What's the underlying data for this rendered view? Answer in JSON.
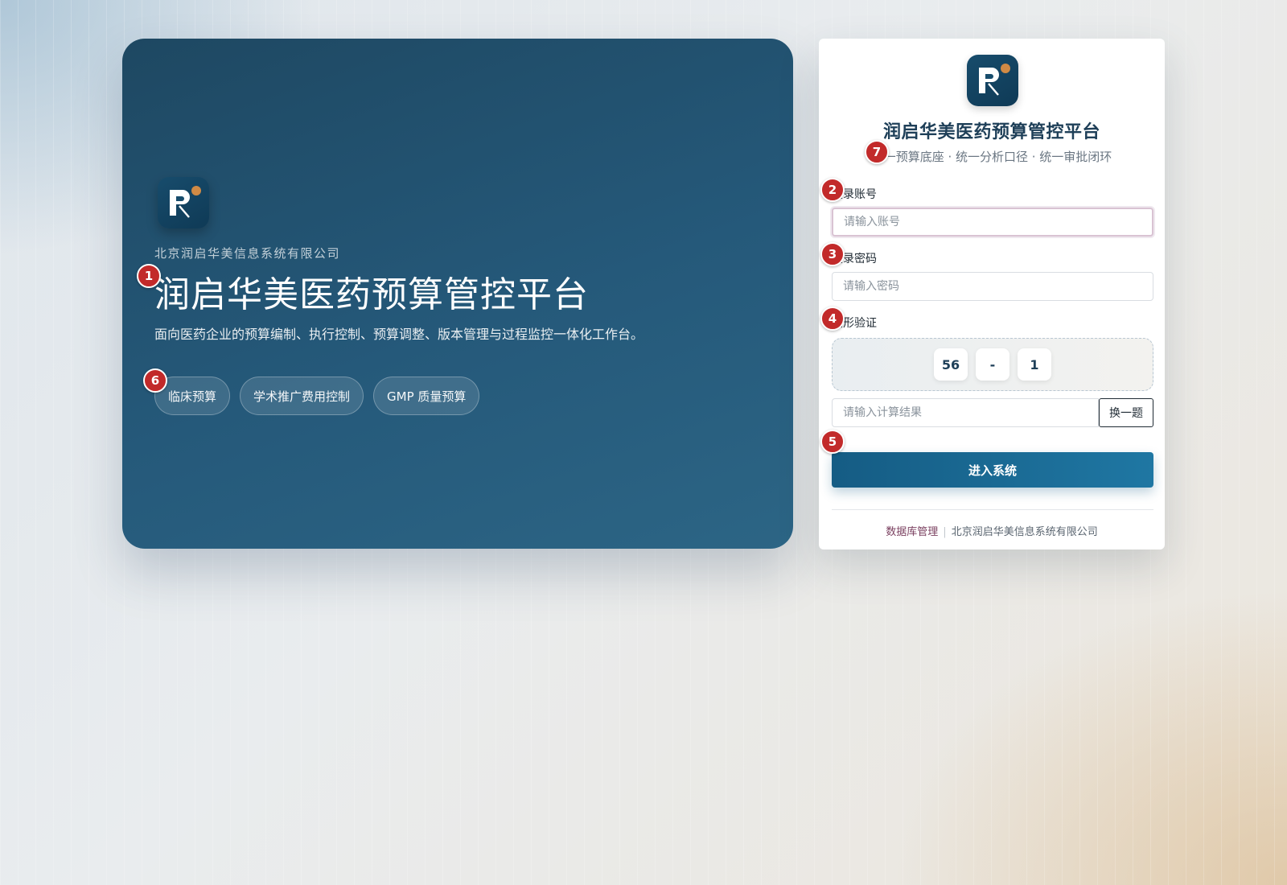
{
  "hero": {
    "company": "北京润启华美信息系统有限公司",
    "title": "润启华美医药预算管控平台",
    "description": "面向医药企业的预算编制、执行控制、预算调整、版本管理与过程监控一体化工作台。",
    "tags": [
      "临床预算",
      "学术推广费用控制",
      "GMP 质量预算"
    ]
  },
  "login": {
    "title": "润启华美医药预算管控平台",
    "subtitle": "统一预算底座 · 统一分析口径 · 统一审批闭环",
    "account_label": "登录账号",
    "account_placeholder": "请输入账号",
    "password_label": "登录密码",
    "password_placeholder": "请输入密码",
    "captcha_label": "图形验证",
    "captcha_tokens": [
      "56",
      "-",
      "1"
    ],
    "captcha_placeholder": "请输入计算结果",
    "swap_label": "换一题",
    "submit_label": "进入系统",
    "footer_link": "数据库管理",
    "footer_company": "北京润启华美信息系统有限公司"
  },
  "markers": [
    "1",
    "2",
    "3",
    "4",
    "5",
    "6",
    "7"
  ],
  "colors": {
    "hero_bg": "#245775",
    "brand": "#1e3f58",
    "button": "#1a6b95",
    "logo_dot": "#d08a45",
    "marker": "#c22a2a"
  }
}
